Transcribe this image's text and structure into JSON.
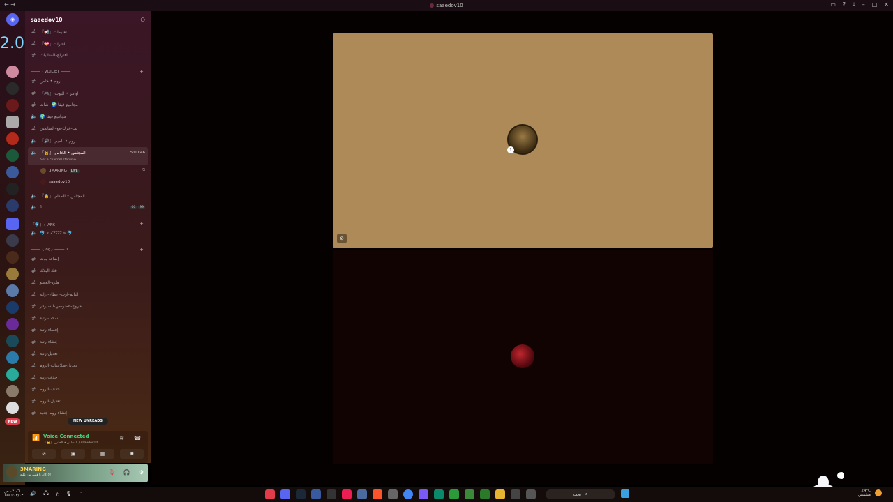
{
  "window": {
    "title": "saaedov10"
  },
  "server": {
    "name": "saaedov10"
  },
  "timer_widget": "2.00",
  "channels": [
    {
      "type": "text",
      "label": "『📢』تعليمات"
    },
    {
      "type": "text",
      "label": "『💝』اقترات"
    },
    {
      "type": "text",
      "label": "اقتراح-الفعاليات"
    },
    {
      "type": "category",
      "label": "──── {VOICE} ────"
    },
    {
      "type": "text",
      "label": "روم • خاص"
    },
    {
      "type": "text",
      "label": "『🎮』 اوامر • البوت"
    },
    {
      "type": "text",
      "label": "مجاميع-فيفا 🌍 -شات"
    },
    {
      "type": "voice",
      "label": "🌍 مجاميع فيفا"
    },
    {
      "type": "text",
      "label": "بث-خرك-مع-المتابعين"
    },
    {
      "type": "voice",
      "label": "『🔊』 روم • الميم"
    },
    {
      "type": "voice",
      "label": "『🔒』 المجلس • الخاص",
      "timer": "5:00:46",
      "status": "Set a channel status ✏"
    },
    {
      "type": "voice",
      "label": "『🔒』 المجلس • المدام"
    },
    {
      "type": "voice",
      "label": "1",
      "badges": [
        "00",
        "99"
      ]
    },
    {
      "type": "category",
      "label": "『🐬』» AFK"
    },
    {
      "type": "voice",
      "label": "🐬 « Zzzzz » 🐬"
    },
    {
      "type": "category",
      "label": "──── {log} ──── 1"
    },
    {
      "type": "text",
      "label": "إضافة-بوت"
    },
    {
      "type": "text",
      "label": "فك-البلاك"
    },
    {
      "type": "text",
      "label": "طرد-العضو"
    },
    {
      "type": "text",
      "label": "التايم-اوت-اعطاء-ازالة"
    },
    {
      "type": "text",
      "label": "خروج-عضو-من-السيرفر"
    },
    {
      "type": "text",
      "label": "سحب-رتبة"
    },
    {
      "type": "text",
      "label": "إعطاء-رتبة"
    },
    {
      "type": "text",
      "label": "إنشاء-رتبة"
    },
    {
      "type": "text",
      "label": "تعديل-رتبة"
    },
    {
      "type": "text",
      "label": "تعديل-صلاحيات-الروم"
    },
    {
      "type": "text",
      "label": "حذف-رتبة"
    },
    {
      "type": "text",
      "label": "حذف-الروم"
    },
    {
      "type": "text",
      "label": "تعديل-الروم"
    },
    {
      "type": "text",
      "label": "إنشاء-روم-جديد"
    }
  ],
  "members": [
    {
      "name": "3MARING",
      "tag": "LIVE"
    },
    {
      "name": "saaedov10"
    }
  ],
  "new_unreads": "NEW UNREADS",
  "new_badge": "NEW",
  "voice": {
    "title": "Voice Connected",
    "subtitle": "『🔒』 المجلس • الخاص / saaedov10"
  },
  "user": {
    "name": "3MARING",
    "status": "كان يا قلبي بين عليه 😢"
  },
  "taskbar": {
    "time": "٠٢:٠٦ ص",
    "date": "١٤٤٦/٠٣/٠٣",
    "lang": "ع",
    "search": "بحث",
    "weather_temp": "24°C",
    "weather_desc": "مشمس"
  },
  "colors": {
    "accent_green": "#4fce7c",
    "tile_top": "#ad8a58",
    "tile_bottom": "#120303",
    "danger": "#e23c4a"
  }
}
